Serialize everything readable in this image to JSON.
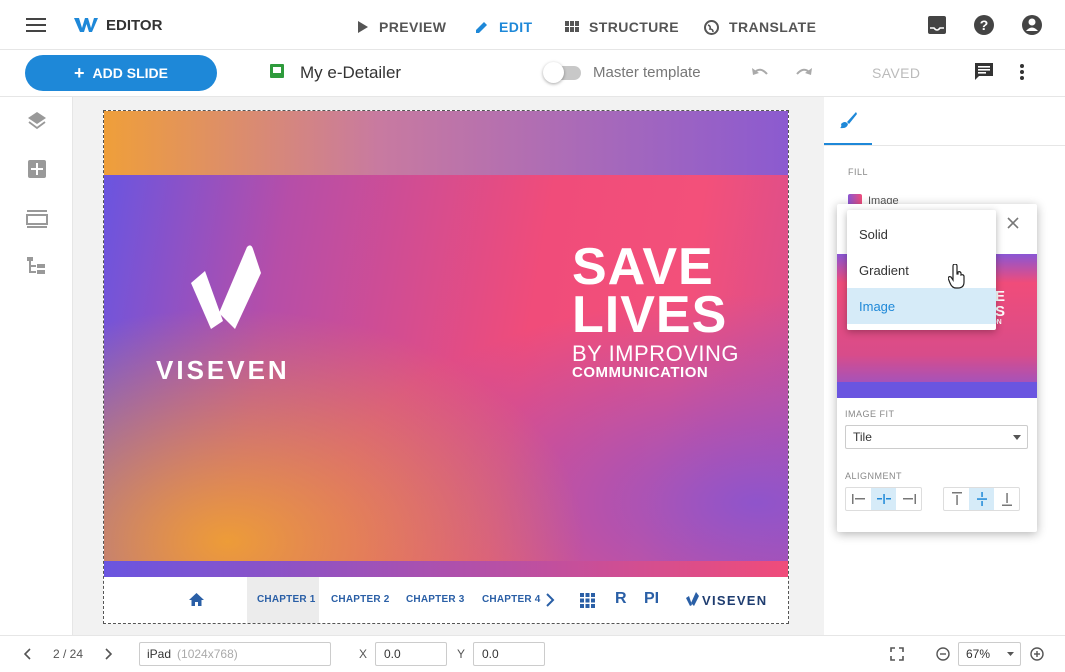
{
  "app": {
    "title": "EDITOR",
    "logo_icon": "w-logo-icon",
    "brand_color": "#1e88d8"
  },
  "nav": {
    "preview": "PREVIEW",
    "edit": "EDIT",
    "structure": "STRUCTURE",
    "translate": "TRANSLATE",
    "active": "EDIT"
  },
  "top_right_icons": [
    "inbox-icon",
    "help-icon",
    "account-icon"
  ],
  "toolbar": {
    "add_slide": "ADD SLIDE",
    "doc_title": "My e-Detailer",
    "master_template": "Master template",
    "master_template_on": false,
    "saved": "SAVED"
  },
  "left_tools": [
    "layers-icon",
    "add-element-icon",
    "slides-icon",
    "structure-tree-icon"
  ],
  "slide": {
    "brand": "VISEVEN",
    "headline_1": "SAVE",
    "headline_2": "LIVES",
    "headline_3": "BY IMPROVING",
    "headline_4": "COMMUNICATION",
    "footer": {
      "chapters": [
        "CHAPTER 1",
        "CHAPTER 2",
        "CHAPTER 3",
        "CHAPTER 4"
      ],
      "r": "R",
      "pi": "PI",
      "brand": "VISEVEN"
    }
  },
  "right_panel": {
    "fill_label": "FILL",
    "fill_value": "Image",
    "fill_options": [
      "Solid",
      "Gradient",
      "Image"
    ],
    "fill_selected": "Image",
    "image_fit_label": "IMAGE FIT",
    "image_fit_value": "Tile",
    "alignment_label": "ALIGNMENT",
    "preview_text_1": "VE",
    "preview_text_2": "ES",
    "preview_text_3": "TION"
  },
  "bottom": {
    "page": "2 / 24",
    "device": "iPad",
    "device_res": "(1024x768)",
    "x_label": "X",
    "x_value": "0.0",
    "y_label": "Y",
    "y_value": "0.0",
    "zoom": "67%"
  }
}
